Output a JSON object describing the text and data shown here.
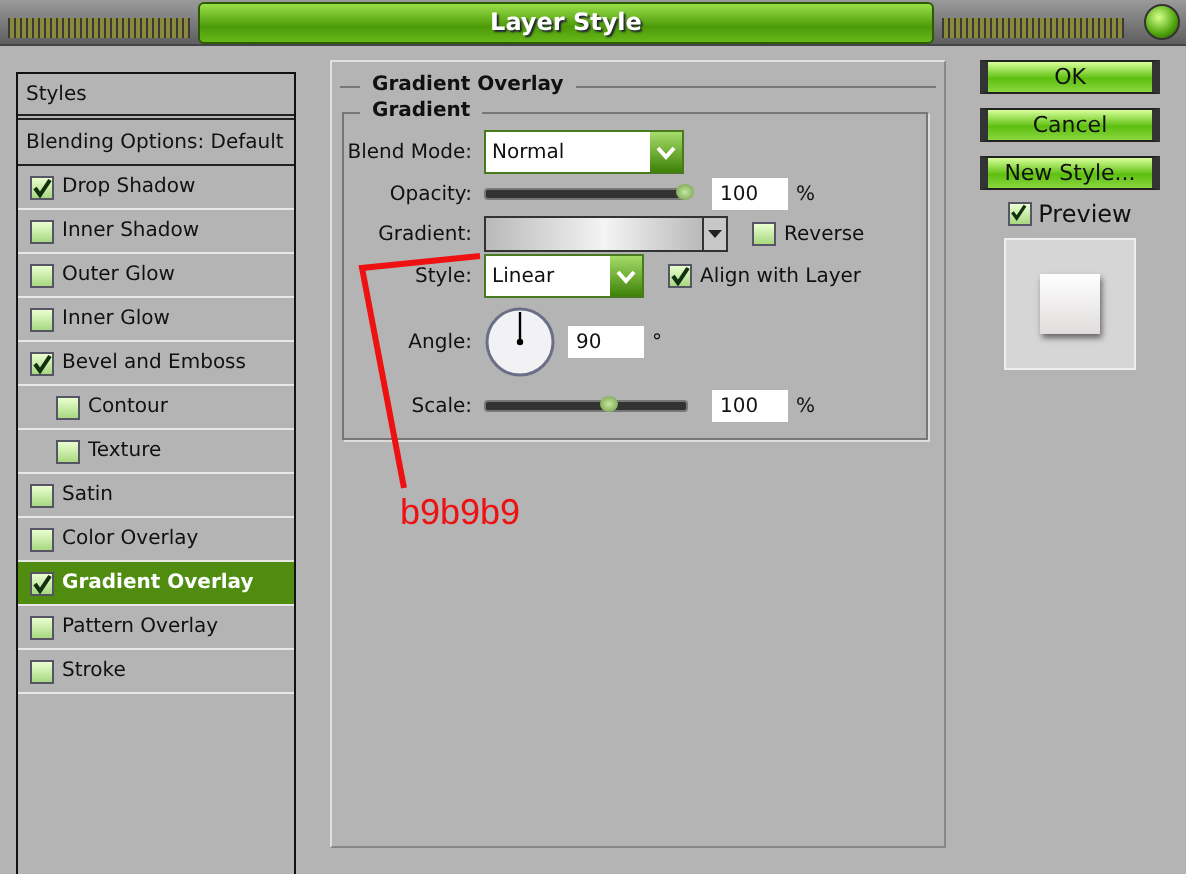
{
  "window": {
    "title": "Layer Style"
  },
  "sidebar": {
    "header": "Styles",
    "items": [
      {
        "label": "Blending Options: Default",
        "kind": "plain",
        "selected": false
      },
      {
        "label": "Drop Shadow",
        "kind": "check",
        "checked": true,
        "selected": false
      },
      {
        "label": "Inner Shadow",
        "kind": "check",
        "checked": false,
        "selected": false
      },
      {
        "label": "Outer Glow",
        "kind": "check",
        "checked": false,
        "selected": false
      },
      {
        "label": "Inner Glow",
        "kind": "check",
        "checked": false,
        "selected": false
      },
      {
        "label": "Bevel and Emboss",
        "kind": "check",
        "checked": true,
        "selected": false,
        "children": [
          {
            "label": "Contour",
            "kind": "check",
            "checked": false,
            "selected": false
          },
          {
            "label": "Texture",
            "kind": "check",
            "checked": false,
            "selected": false
          }
        ]
      },
      {
        "label": "Satin",
        "kind": "check",
        "checked": false,
        "selected": false
      },
      {
        "label": "Color Overlay",
        "kind": "check",
        "checked": false,
        "selected": false
      },
      {
        "label": "Gradient Overlay",
        "kind": "check",
        "checked": true,
        "selected": true
      },
      {
        "label": "Pattern Overlay",
        "kind": "check",
        "checked": false,
        "selected": false
      },
      {
        "label": "Stroke",
        "kind": "check",
        "checked": false,
        "selected": false
      }
    ]
  },
  "panel": {
    "title": "Gradient Overlay",
    "group": "Gradient",
    "blend_mode": {
      "label": "Blend Mode:",
      "value": "Normal"
    },
    "opacity": {
      "label": "Opacity:",
      "level": 1,
      "value": "100",
      "unit": "%"
    },
    "gradient": {
      "label": "Gradient:"
    },
    "reverse": {
      "label": "Reverse",
      "checked": false
    },
    "style": {
      "label": "Style:",
      "value": "Linear"
    },
    "align": {
      "label": "Align with Layer",
      "checked": true
    },
    "angle": {
      "label": "Angle:",
      "value": "90",
      "unit": "°"
    },
    "scale": {
      "label": "Scale:",
      "level": 0.62,
      "value": "100",
      "unit": "%"
    }
  },
  "buttons": [
    "OK",
    "Cancel",
    "New Style..."
  ],
  "preview": {
    "label": "Preview",
    "checked": true
  },
  "annotation": {
    "text": "b9b9b9"
  }
}
